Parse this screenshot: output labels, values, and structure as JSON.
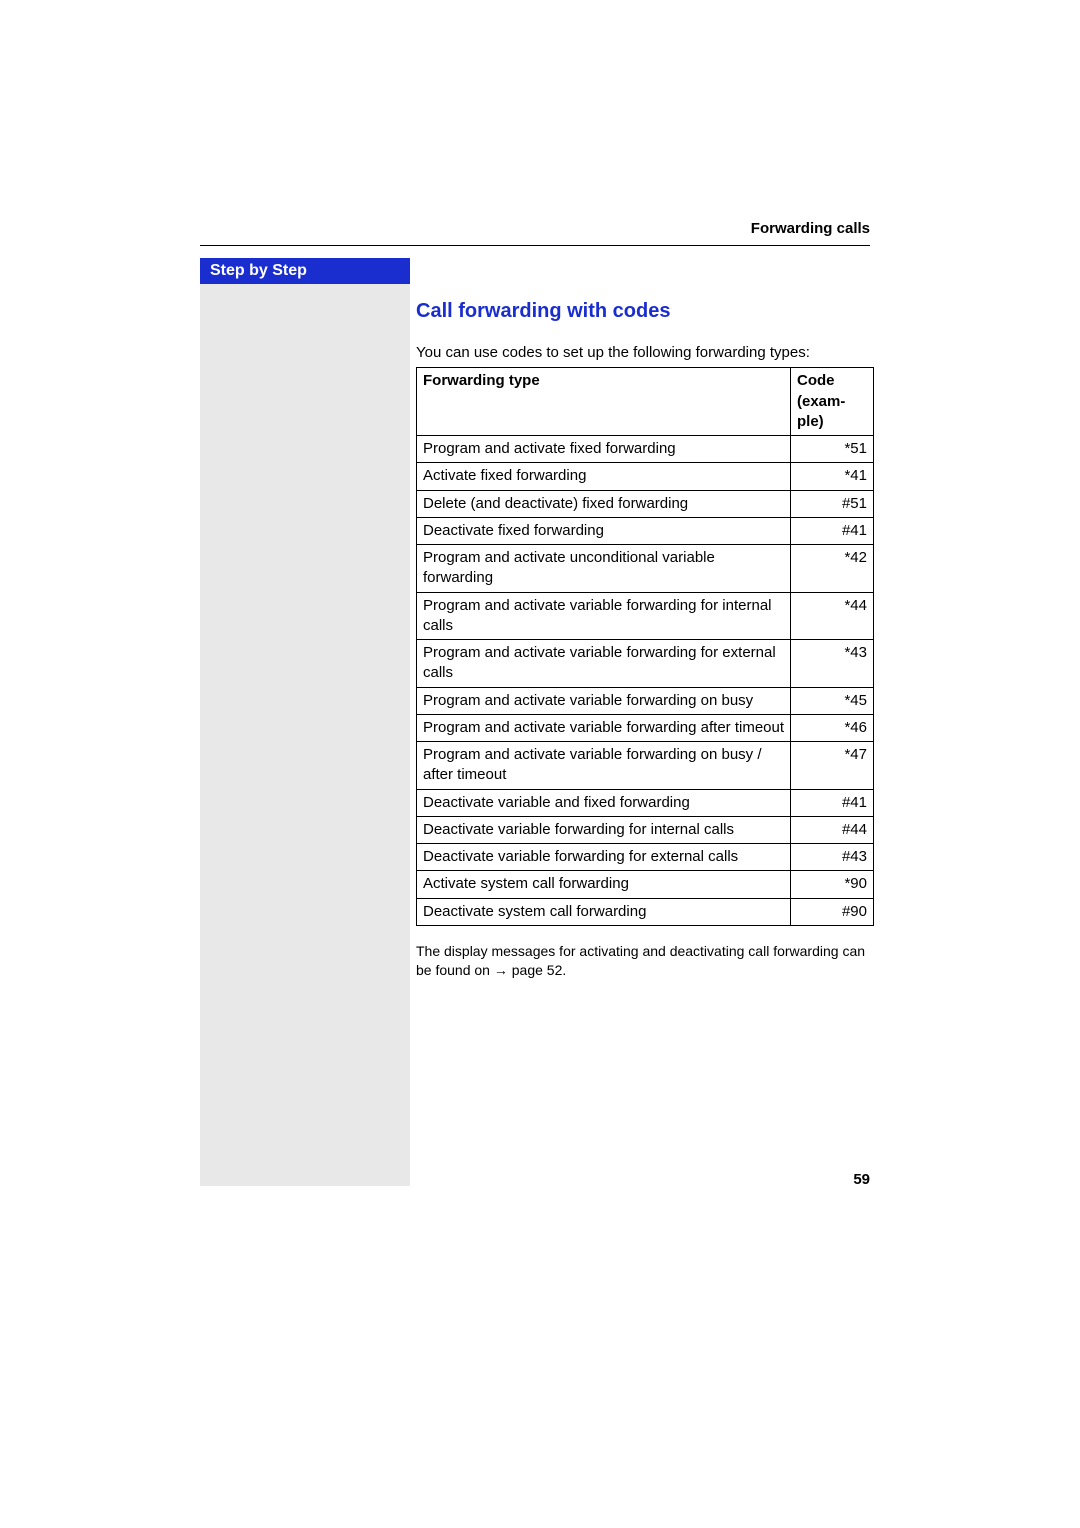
{
  "running_head": "Forwarding calls",
  "sidebar_label": "Step by Step",
  "section_title": "Call forwarding with codes",
  "intro": "You can use codes to set up the following forwarding types:",
  "table": {
    "header_type": "Forwarding type",
    "header_code": "Code (exam-ple)",
    "rows": [
      {
        "type": "Program and activate fixed forwarding",
        "code": "*51"
      },
      {
        "type": "Activate fixed forwarding",
        "code": "*41"
      },
      {
        "type": "Delete (and deactivate) fixed forwarding",
        "code": "#51"
      },
      {
        "type": "Deactivate fixed forwarding",
        "code": "#41"
      },
      {
        "type": "Program and activate unconditional variable forwarding",
        "code": "*42"
      },
      {
        "type": "Program and activate variable forwarding for internal calls",
        "code": "*44"
      },
      {
        "type": "Program and activate variable forwarding for external calls",
        "code": "*43"
      },
      {
        "type": "Program and activate variable forwarding on busy",
        "code": "*45"
      },
      {
        "type": "Program and activate variable forwarding after timeout",
        "code": "*46"
      },
      {
        "type": "Program and activate variable forwarding on busy / after timeout",
        "code": "*47"
      },
      {
        "type": "Deactivate variable and fixed forwarding",
        "code": "#41"
      },
      {
        "type": "Deactivate variable forwarding for internal calls",
        "code": "#44"
      },
      {
        "type": "Deactivate variable forwarding for external calls",
        "code": "#43"
      },
      {
        "type": "Activate system call forwarding",
        "code": "*90"
      },
      {
        "type": "Deactivate system call forwarding",
        "code": "#90"
      }
    ]
  },
  "footnote_part1": "The display messages for activating and deactivating call forwarding can be found on ",
  "footnote_pageref": "→ page 52.",
  "page_number": "59"
}
